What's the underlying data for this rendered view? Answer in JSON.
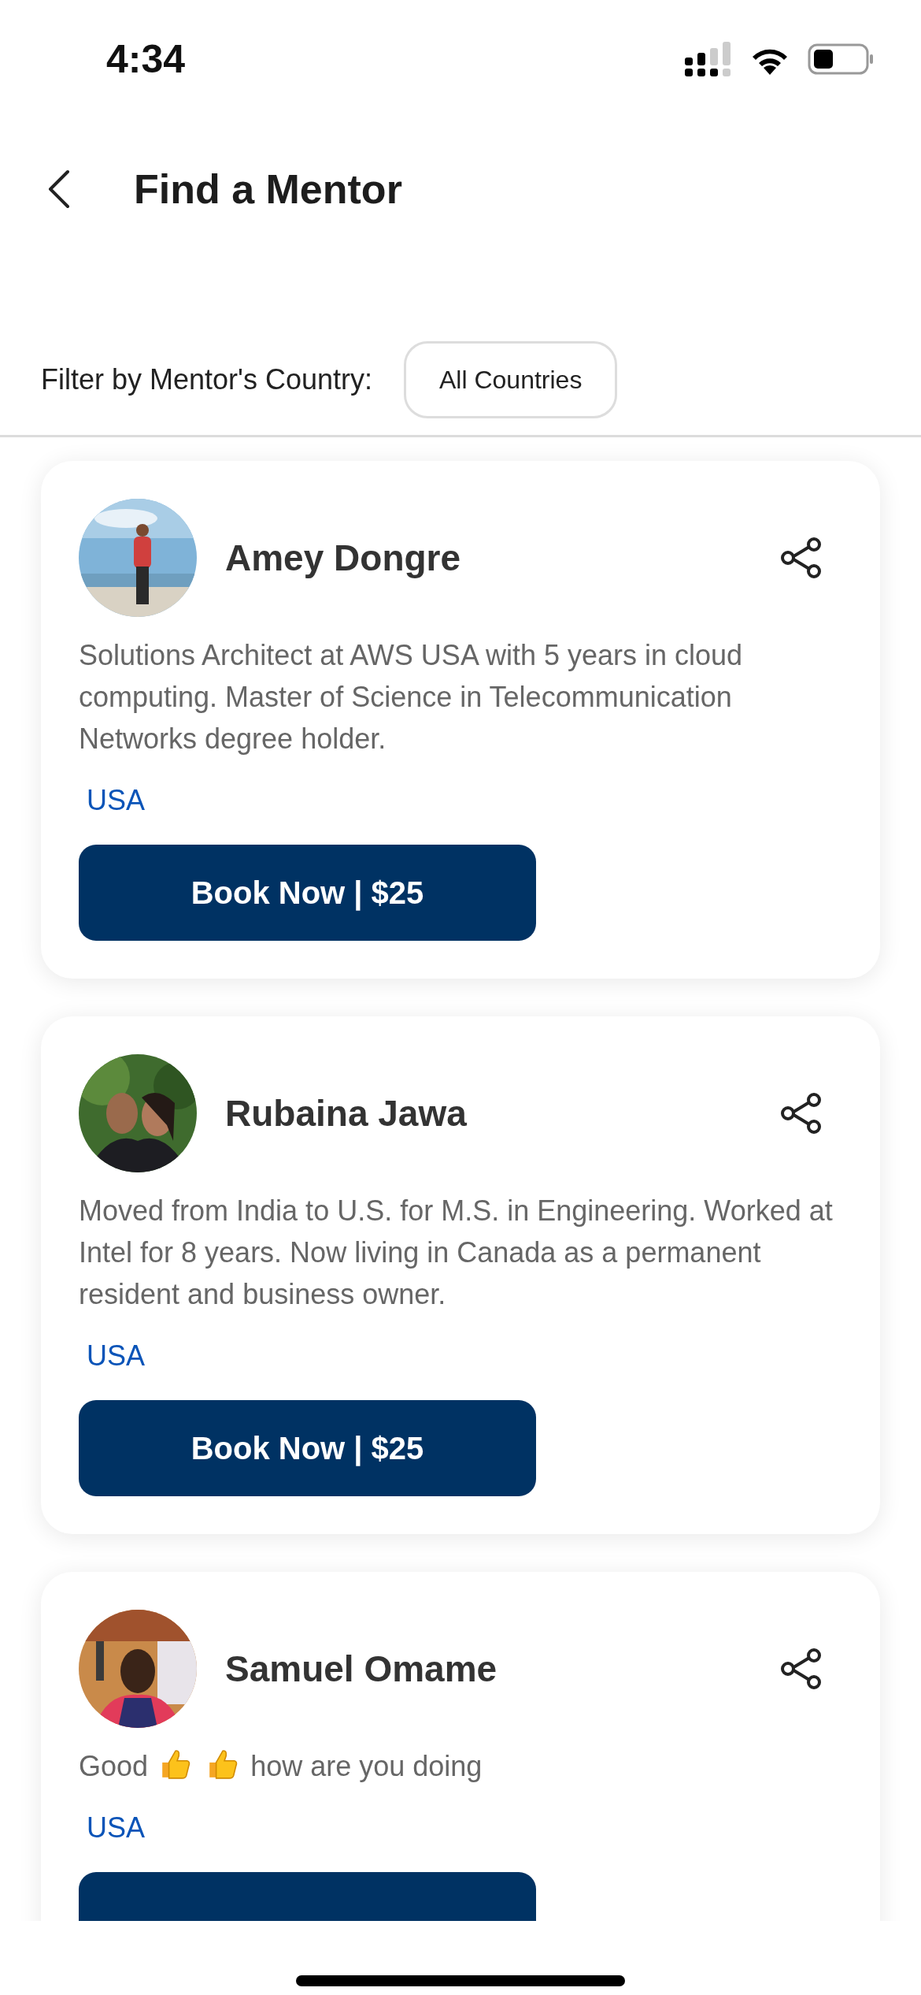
{
  "status_bar": {
    "time": "4:34"
  },
  "header": {
    "title": "Find a Mentor"
  },
  "filter": {
    "label": "Filter by Mentor's Country:",
    "value": "All Countries"
  },
  "mentors": [
    {
      "name": "Amey Dongre",
      "bio": [
        {
          "kind": "text",
          "text": "Solutions Architect at AWS USA with 5 years in cloud computing. Master of Science in Telecommunication Networks degree holder."
        }
      ],
      "country": "USA",
      "button_label": "Book Now | $25"
    },
    {
      "name": "Rubaina Jawa",
      "bio": [
        {
          "kind": "text",
          "text": "Moved from India to U.S. for M.S. in Engineering. Worked at Intel for 8 years. Now living in Canada as a permanent resident and business owner."
        }
      ],
      "country": "USA",
      "button_label": "Book Now | $25"
    },
    {
      "name": "Samuel Omame",
      "bio": [
        {
          "kind": "text",
          "text": "Good"
        },
        {
          "kind": "thumbs_up"
        },
        {
          "kind": "thumbs_up"
        },
        {
          "kind": "text",
          "text": "how are you doing"
        }
      ],
      "country": "USA"
    }
  ]
}
